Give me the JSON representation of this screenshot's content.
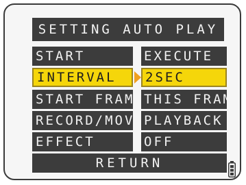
{
  "title": "SETTING AUTO PLAY",
  "menu": [
    {
      "label": "START",
      "value": "EXECUTE",
      "selected": false
    },
    {
      "label": "INTERVAL",
      "value": "2SEC",
      "selected": true
    },
    {
      "label": "START FRAME",
      "value": "THIS FRAME",
      "selected": false
    },
    {
      "label": "RECORD/MOVIE",
      "value": "PLAYBACK",
      "selected": false
    },
    {
      "label": "EFFECT",
      "value": "OFF",
      "selected": false
    }
  ],
  "return_label": "RETURN",
  "battery": {
    "icon": "battery-icon",
    "level": 1.0
  },
  "colors": {
    "bar": "#3c3c3c",
    "highlight": "#f5d60a",
    "pointer": "#f0a020",
    "text": "#f2f2f2"
  }
}
